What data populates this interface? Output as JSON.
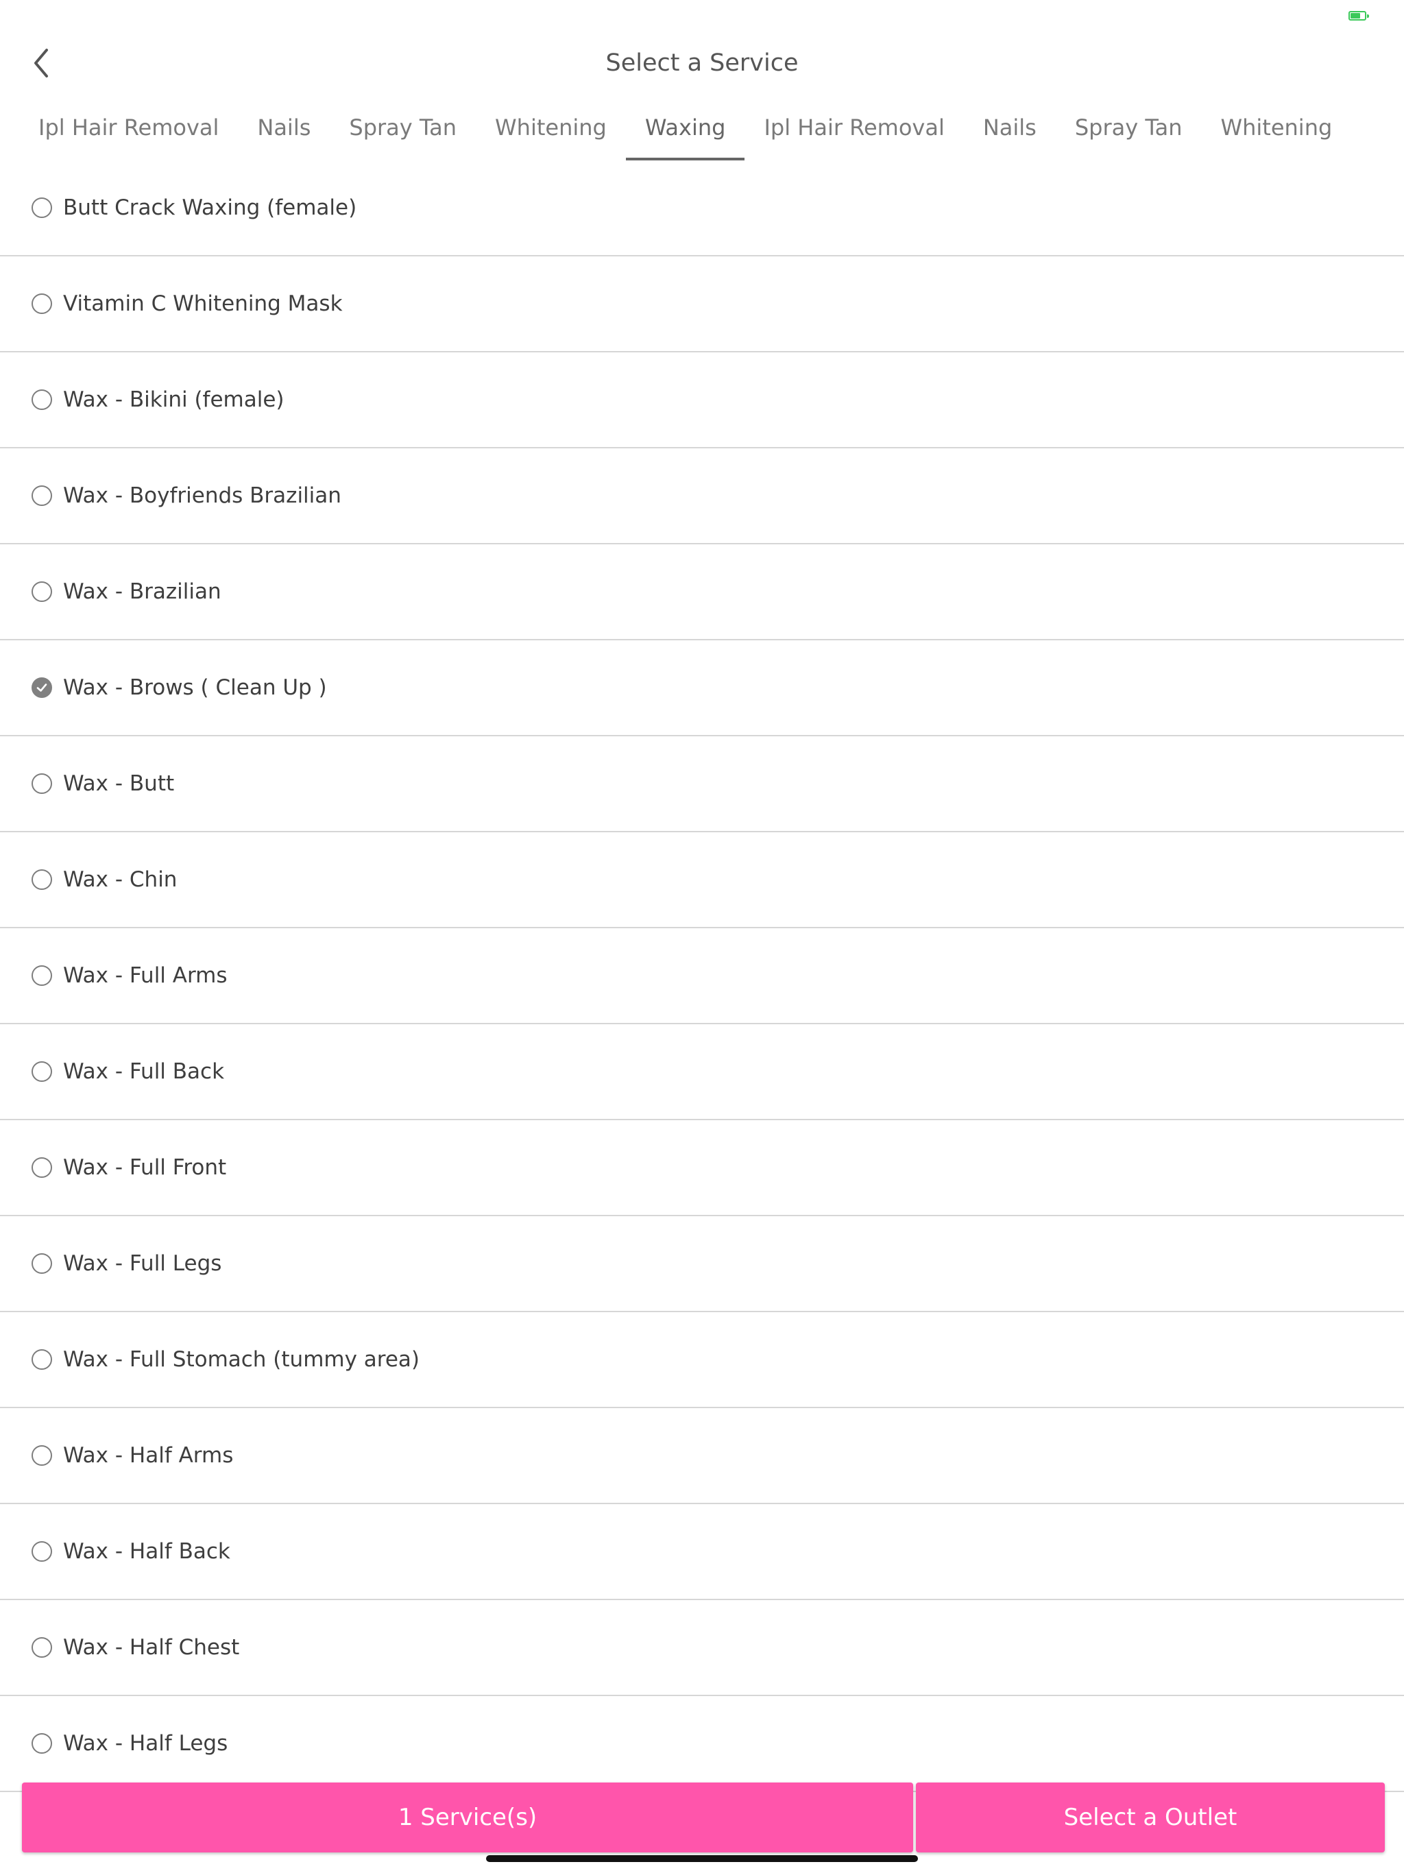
{
  "header": {
    "title": "Select a Service"
  },
  "tabs": [
    {
      "label": "Ipl Hair Removal",
      "active": false
    },
    {
      "label": "Nails",
      "active": false
    },
    {
      "label": "Spray Tan",
      "active": false
    },
    {
      "label": "Whitening",
      "active": false
    },
    {
      "label": "Waxing",
      "active": true
    },
    {
      "label": "Ipl Hair Removal",
      "active": false
    },
    {
      "label": "Nails",
      "active": false
    },
    {
      "label": "Spray Tan",
      "active": false
    },
    {
      "label": "Whitening",
      "active": false
    }
  ],
  "services": [
    {
      "label": "Butt Crack Waxing (female)",
      "selected": false
    },
    {
      "label": "Vitamin C Whitening Mask",
      "selected": false
    },
    {
      "label": "Wax - Bikini (female)",
      "selected": false
    },
    {
      "label": "Wax - Boyfriends Brazilian",
      "selected": false
    },
    {
      "label": "Wax - Brazilian",
      "selected": false
    },
    {
      "label": "Wax - Brows ( Clean Up )",
      "selected": true
    },
    {
      "label": "Wax - Butt",
      "selected": false
    },
    {
      "label": "Wax - Chin",
      "selected": false
    },
    {
      "label": "Wax - Full Arms",
      "selected": false
    },
    {
      "label": "Wax - Full Back",
      "selected": false
    },
    {
      "label": "Wax - Full Front",
      "selected": false
    },
    {
      "label": "Wax - Full Legs",
      "selected": false
    },
    {
      "label": "Wax - Full Stomach (tummy area)",
      "selected": false
    },
    {
      "label": "Wax - Half Arms",
      "selected": false
    },
    {
      "label": "Wax - Half Back",
      "selected": false
    },
    {
      "label": "Wax - Half Chest",
      "selected": false
    },
    {
      "label": "Wax - Half Legs",
      "selected": false
    }
  ],
  "footer": {
    "services_button": "1 Service(s)",
    "outlet_button": "Select a Outlet"
  },
  "colors": {
    "accent": "#ff55ab",
    "battery": "#3cc95a"
  }
}
